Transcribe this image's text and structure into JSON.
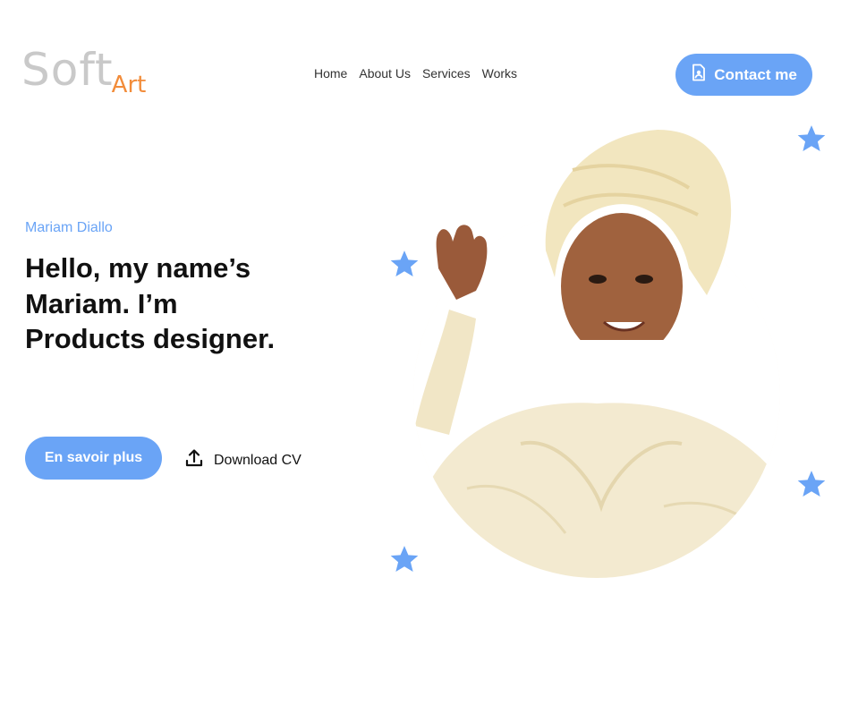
{
  "header": {
    "logo": {
      "part1": "Soft",
      "part2": "Art"
    },
    "nav": [
      {
        "label": "Home"
      },
      {
        "label": "About Us"
      },
      {
        "label": "Services"
      },
      {
        "label": "Works"
      }
    ],
    "contact_label": "Contact me",
    "contact_icon": "contact-card-icon"
  },
  "hero": {
    "name": "Mariam Diallo",
    "headline": "Hello, my name’s Mariam. I’m Products designer.",
    "cta_label": "En savoir plus",
    "download_label": "Download CV",
    "download_icon": "upload-icon"
  },
  "decor": {
    "star_icon": "star-icon",
    "accent_color": "#6aa4f6",
    "logo_accent_color": "#f28c3a"
  }
}
